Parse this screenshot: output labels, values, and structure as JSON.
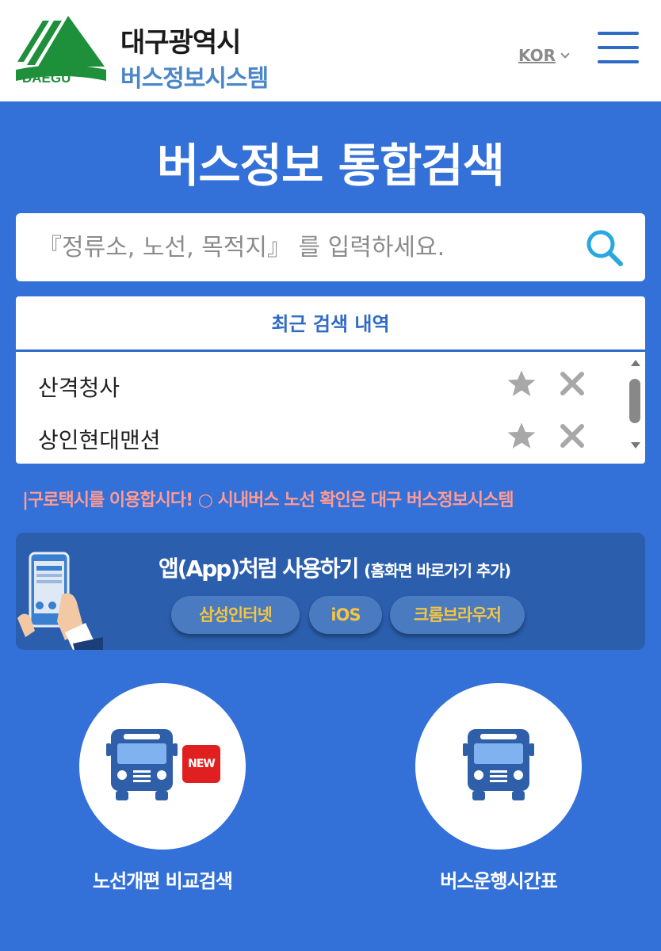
{
  "header": {
    "logo_text": "DAEGU",
    "title": "대구광역시",
    "subtitle": "버스정보시스템",
    "lang": "KOR"
  },
  "main": {
    "title": "버스정보 통합검색"
  },
  "search": {
    "placeholder": "『정류소, 노선, 목적지』 를 입력하세요."
  },
  "recent": {
    "title": "최근 검색 내역",
    "items": [
      {
        "name": "산격청사"
      },
      {
        "name": "상인현대맨션"
      }
    ]
  },
  "notice": {
    "text": "|구로택시를 이용합시다!   ○ 시내버스 노선 확인은 대구 버스정보시스템"
  },
  "banner": {
    "title": "앱(App)처럼 사용하기",
    "title_small": "(홈화면 바로가기 추가)",
    "buttons": [
      "삼성인터넷",
      "iOS",
      "크롬브라우저"
    ]
  },
  "cards": [
    {
      "label": "노선개편 비교검색",
      "badge": "NEW"
    },
    {
      "label": "버스운행시간표"
    }
  ],
  "colors": {
    "background": "#3370d8",
    "accent": "#2f6bc4",
    "logo_green": "#1e8f3a",
    "notice": "#ff9b93",
    "pill_text": "#f4c542",
    "badge": "#e02020"
  },
  "icons": {
    "search": "search-icon",
    "star": "star-icon",
    "delete": "close-icon",
    "menu": "hamburger-menu-icon",
    "bus": "bus-icon"
  }
}
